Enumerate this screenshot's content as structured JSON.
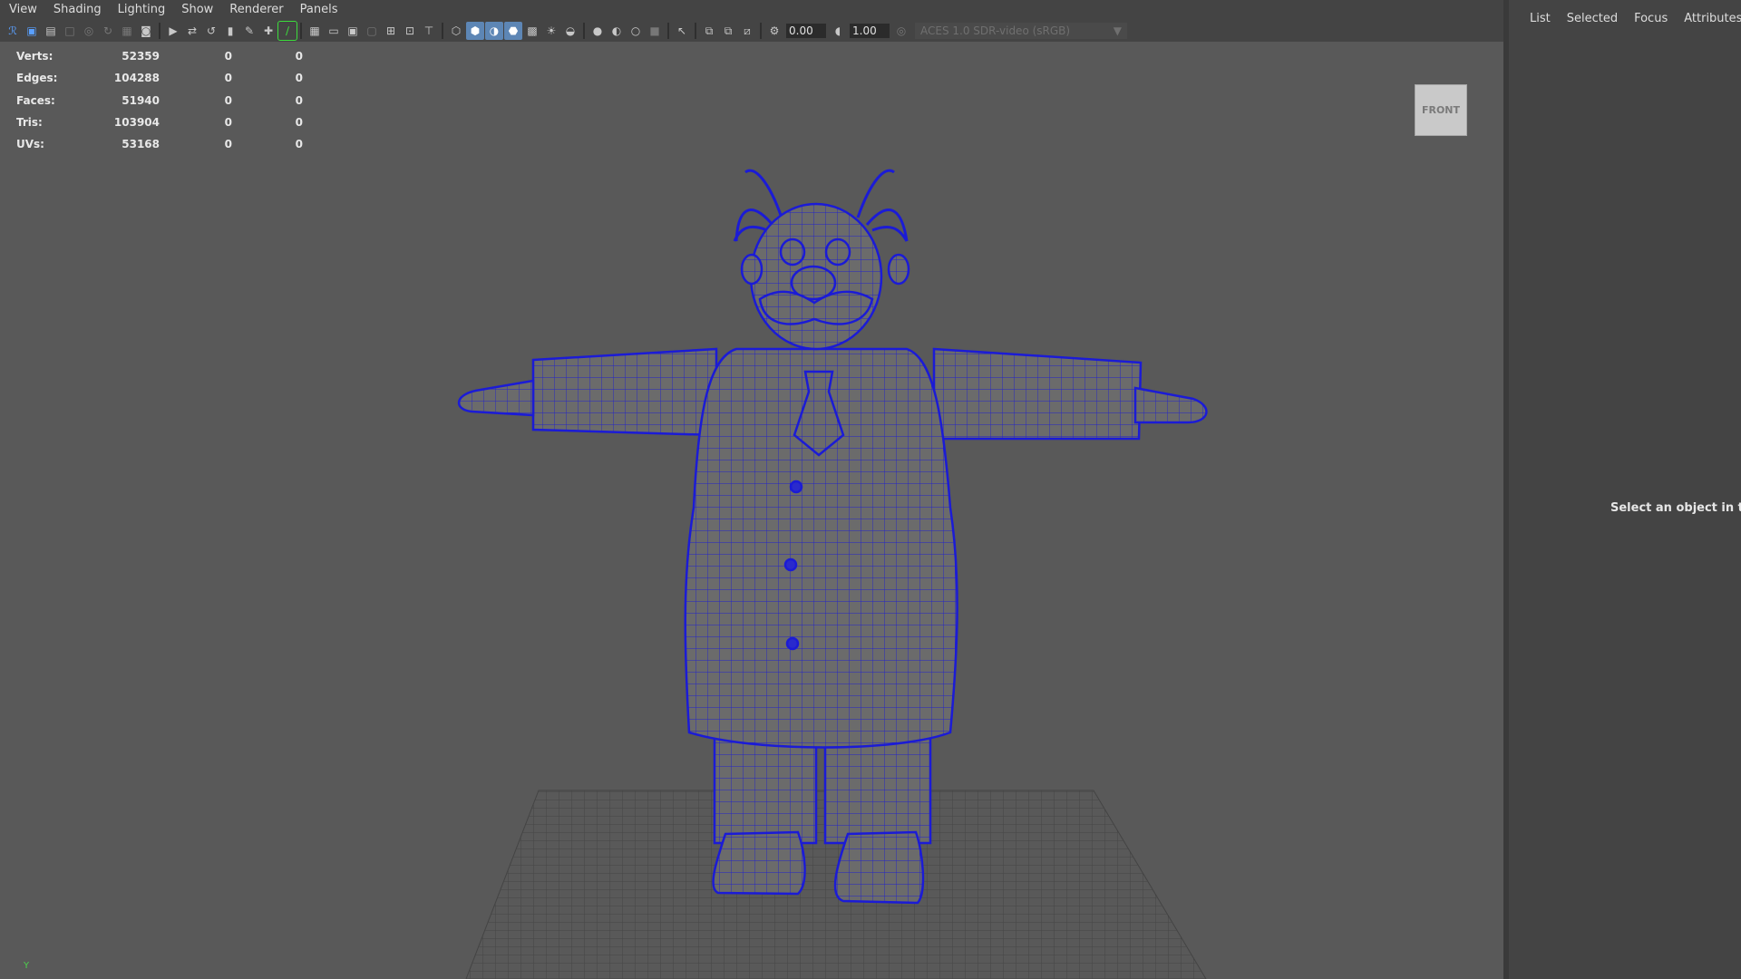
{
  "menubar": {
    "items": [
      "View",
      "Shading",
      "Lighting",
      "Show",
      "Renderer",
      "Panels"
    ]
  },
  "toolbar": {
    "exposure_value": "0.00",
    "gamma_value": "1.00",
    "color_space": "ACES 1.0 SDR-video (sRGB)",
    "icons": [
      "select-camera-icon",
      "camera-attributes-icon",
      "bookmark-icon",
      "image-plane-icon",
      "grid-icon",
      "film-gate-icon",
      "wireframe-icon",
      "smooth-shade-icon",
      "textured-icon",
      "lighting-icon",
      "shadows-icon",
      "isolate-icon",
      "xray-icon",
      "exposure-icon",
      "gamma-icon"
    ]
  },
  "hud": {
    "rows": [
      {
        "label": "Verts:",
        "v1": "52359",
        "v2": "0",
        "v3": "0"
      },
      {
        "label": "Edges:",
        "v1": "104288",
        "v2": "0",
        "v3": "0"
      },
      {
        "label": "Faces:",
        "v1": "51940",
        "v2": "0",
        "v3": "0"
      },
      {
        "label": "Tris:",
        "v1": "103904",
        "v2": "0",
        "v3": "0"
      },
      {
        "label": "UVs:",
        "v1": "53168",
        "v2": "0",
        "v3": "0"
      }
    ]
  },
  "viewcube": {
    "label": "FRONT"
  },
  "axis": {
    "y_label": "Y"
  },
  "side_panel": {
    "tabs": [
      "List",
      "Selected",
      "Focus",
      "Attributes"
    ],
    "message": "Select an object in the s"
  },
  "colors": {
    "viewport_bg": "#595959",
    "wire": "#1b1bd6",
    "body": "#6a6a6a",
    "panel": "#444444"
  }
}
